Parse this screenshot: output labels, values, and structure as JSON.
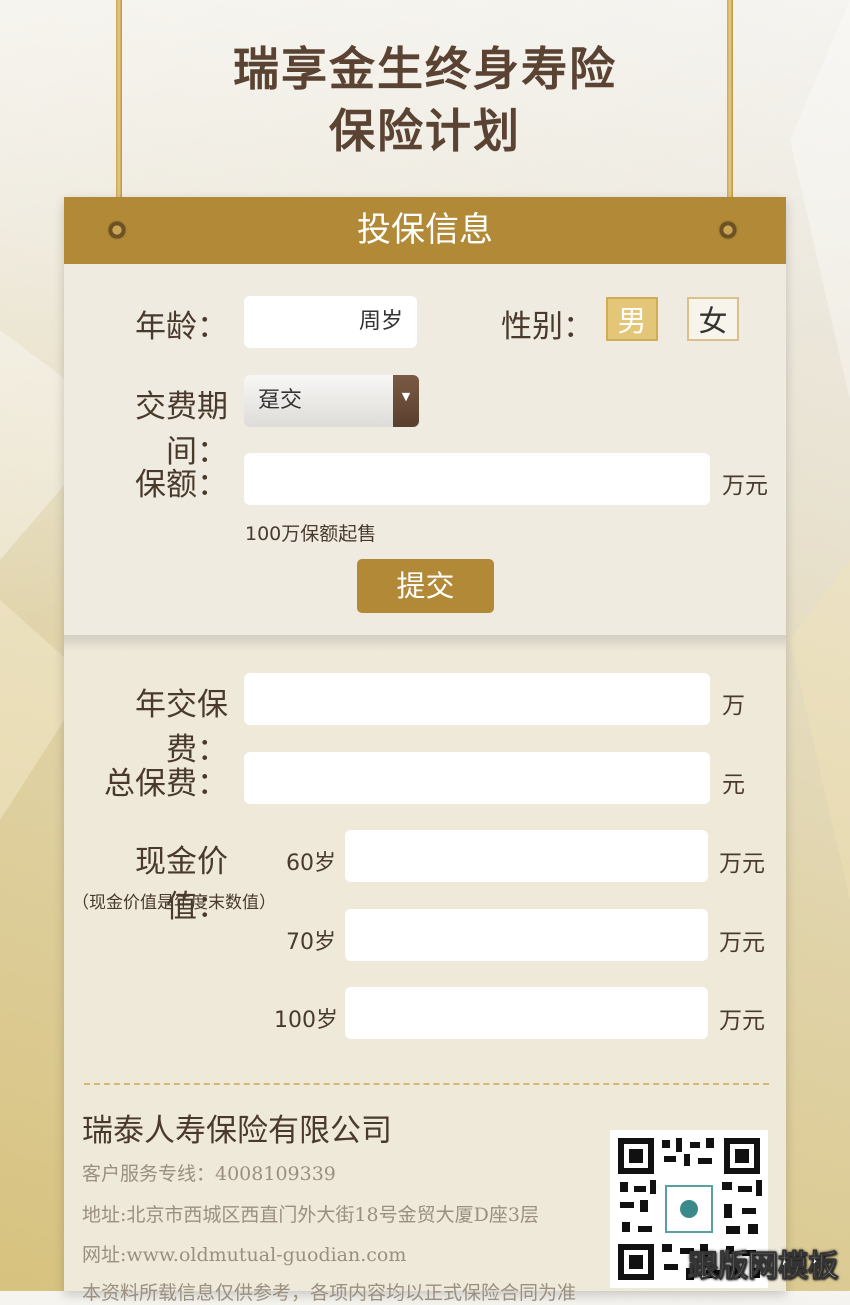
{
  "header": {
    "title_line1": "瑞享金生终身寿险",
    "title_line2": "保险计划"
  },
  "form": {
    "section_title": "投保信息",
    "age_label": "年龄：",
    "age_value": "",
    "age_suffix": "周岁",
    "gender_label": "性别：",
    "gender_male": "男",
    "gender_female": "女",
    "gender_selected": "男",
    "period_label": "交费期间：",
    "period_selected": "趸交",
    "period_arrow": "▼",
    "amount_label": "保额：",
    "amount_value": "",
    "amount_unit": "万元",
    "amount_hint": "100万保额起售",
    "submit_label": "提交"
  },
  "results": {
    "annual_premium_label": "年交保费：",
    "annual_premium_value": "",
    "annual_premium_unit": "万",
    "total_premium_label": "总保费：",
    "total_premium_value": "",
    "total_premium_unit": "元",
    "cash_value_label": "现金价值：",
    "cash_value_note": "（现金价值是年度末数值）",
    "cash_values": [
      {
        "age": "60岁",
        "value": "",
        "unit": "万元"
      },
      {
        "age": "70岁",
        "value": "",
        "unit": "万元"
      },
      {
        "age": "100岁",
        "value": "",
        "unit": "万元"
      }
    ]
  },
  "footer": {
    "company": "瑞泰人寿保险有限公司",
    "hotline": "客户服务专线：4008109339",
    "address": "地址:北京市西城区西直门外大街18号金贸大厦D座3层",
    "website": "网址:www.oldmutual-guodian.com",
    "disclaimer": "本资料所载信息仅供参考，各项内容均以正式保险合同为准",
    "qr_icon": "qr-code-icon"
  },
  "watermark": "跟版网模板",
  "colors": {
    "accent": "#b18937",
    "title": "#5a4333",
    "gender_active": "#e3c677"
  }
}
